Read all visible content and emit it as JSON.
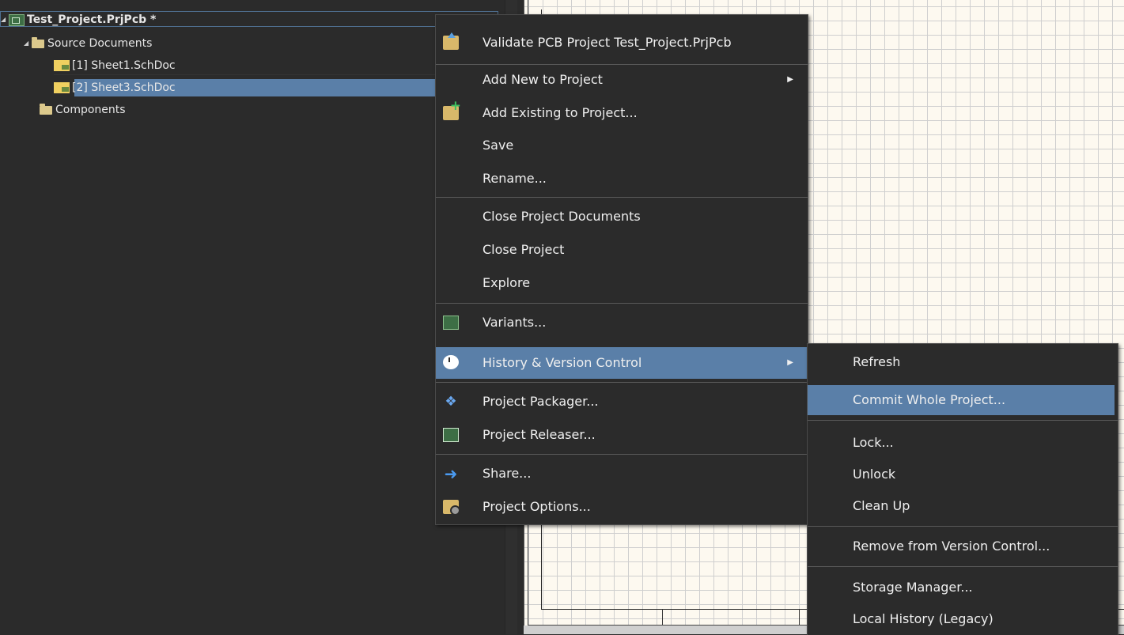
{
  "project_tree": {
    "project": "Test_Project.PrjPcb *",
    "source_folder": "Source Documents",
    "documents": [
      "[1] Sheet1.SchDoc",
      "[2] Sheet3.SchDoc"
    ],
    "components_folder": "Components"
  },
  "context_menu": {
    "validate": "Validate PCB Project Test_Project.PrjPcb",
    "add_new": "Add New to Project",
    "add_existing": "Add Existing to Project...",
    "save": "Save",
    "rename": "Rename...",
    "close_docs": "Close Project Documents",
    "close_project": "Close Project",
    "explore": "Explore",
    "variants": "Variants...",
    "history": "History & Version Control",
    "packager": "Project Packager...",
    "releaser": "Project Releaser...",
    "share": "Share...",
    "options": "Project Options..."
  },
  "submenu": {
    "refresh": "Refresh",
    "commit": "Commit Whole Project...",
    "lock": "Lock...",
    "unlock": "Unlock",
    "cleanup": "Clean Up",
    "remove": "Remove from Version Control...",
    "storage": "Storage Manager...",
    "local_history": "Local History (Legacy)"
  },
  "colors": {
    "panel_bg": "#2b2b2b",
    "highlight": "#5a7fa8",
    "canvas_bg": "#fdf9f0"
  }
}
